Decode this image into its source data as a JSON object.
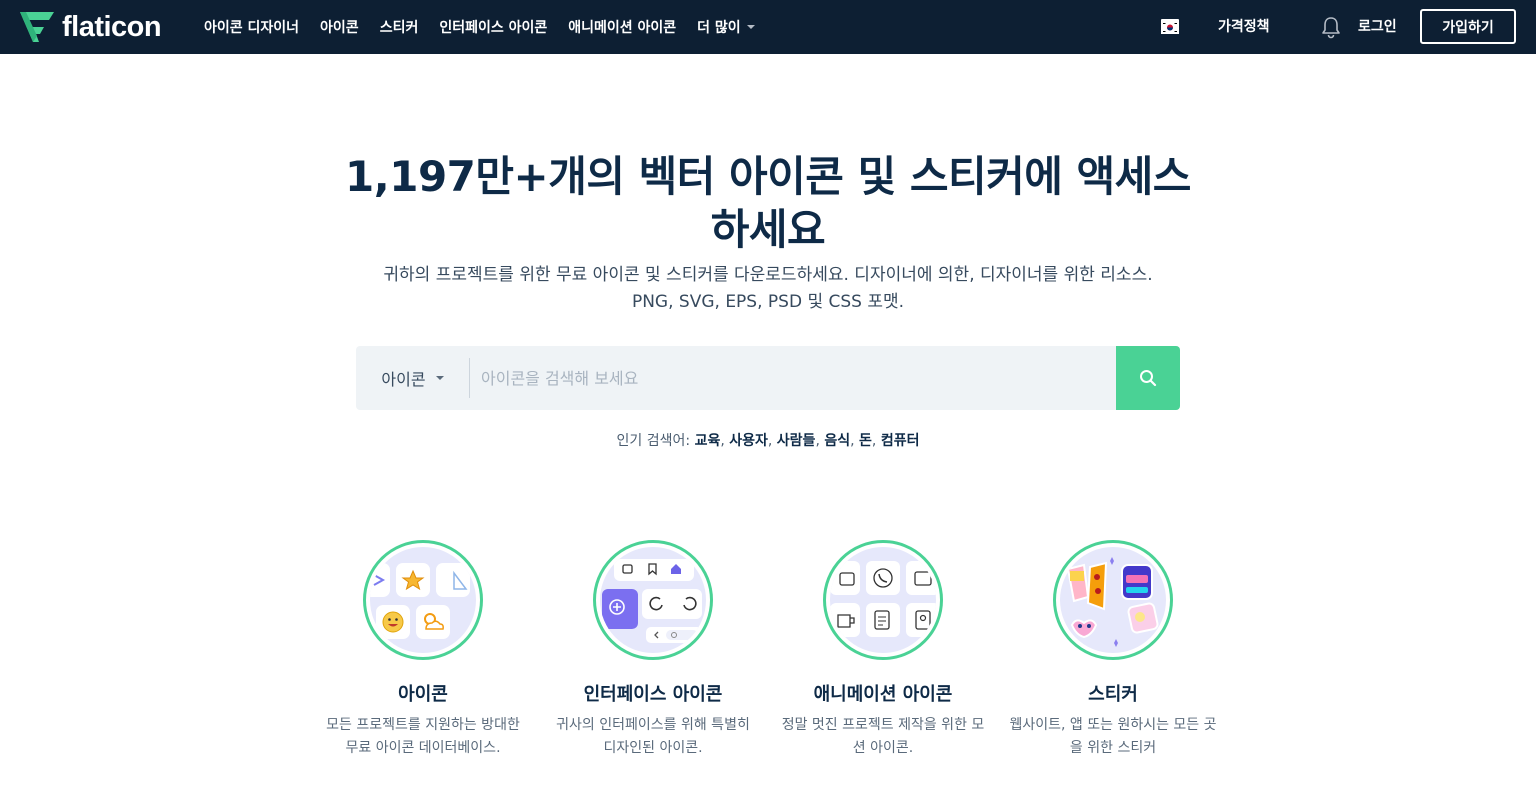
{
  "header": {
    "logo_text": "flaticon",
    "nav": [
      {
        "label": "아이콘 디자이너",
        "has_caret": false
      },
      {
        "label": "아이콘",
        "has_caret": false
      },
      {
        "label": "스티커",
        "has_caret": false
      },
      {
        "label": "인터페이스 아이콘",
        "has_caret": false
      },
      {
        "label": "애니메이션 아이콘",
        "has_caret": false
      },
      {
        "label": "더 많이",
        "has_caret": true
      }
    ],
    "pricing": "가격정책",
    "login": "로그인",
    "signup": "가입하기"
  },
  "hero": {
    "title": "1,197만+개의 벡터 아이콘 및 스티커에 액세스하세요",
    "subtitle": "귀하의 프로젝트를 위한 무료 아이콘 및 스티커를 다운로드하세요. 디자이너에 의한, 디자이너를 위한 리소스. PNG, SVG, EPS, PSD 및 CSS 포맷."
  },
  "search": {
    "type_label": "아이콘",
    "placeholder": "아이콘을 검색해 보세요"
  },
  "popular": {
    "label": "인기 검색어:",
    "terms": [
      "교육",
      "사용자",
      "사람들",
      "음식",
      "돈",
      "컴퓨터"
    ]
  },
  "categories": [
    {
      "title": "아이콘",
      "desc": "모든 프로젝트를 지원하는 방대한 무료 아이콘 데이터베이스."
    },
    {
      "title": "인터페이스 아이콘",
      "desc": "귀사의 인터페이스를 위해 특별히 디자인된 아이콘."
    },
    {
      "title": "애니메이션 아이콘",
      "desc": "정말 멋진 프로젝트 제작을 위한 모션 아이콘."
    },
    {
      "title": "스티커",
      "desc": "웹사이트, 앱 또는 원하시는 모든 곳을 위한 스티커"
    }
  ],
  "colors": {
    "nav_bg": "#0d1f33",
    "accent": "#4ad295",
    "heading": "#0e2a47"
  }
}
